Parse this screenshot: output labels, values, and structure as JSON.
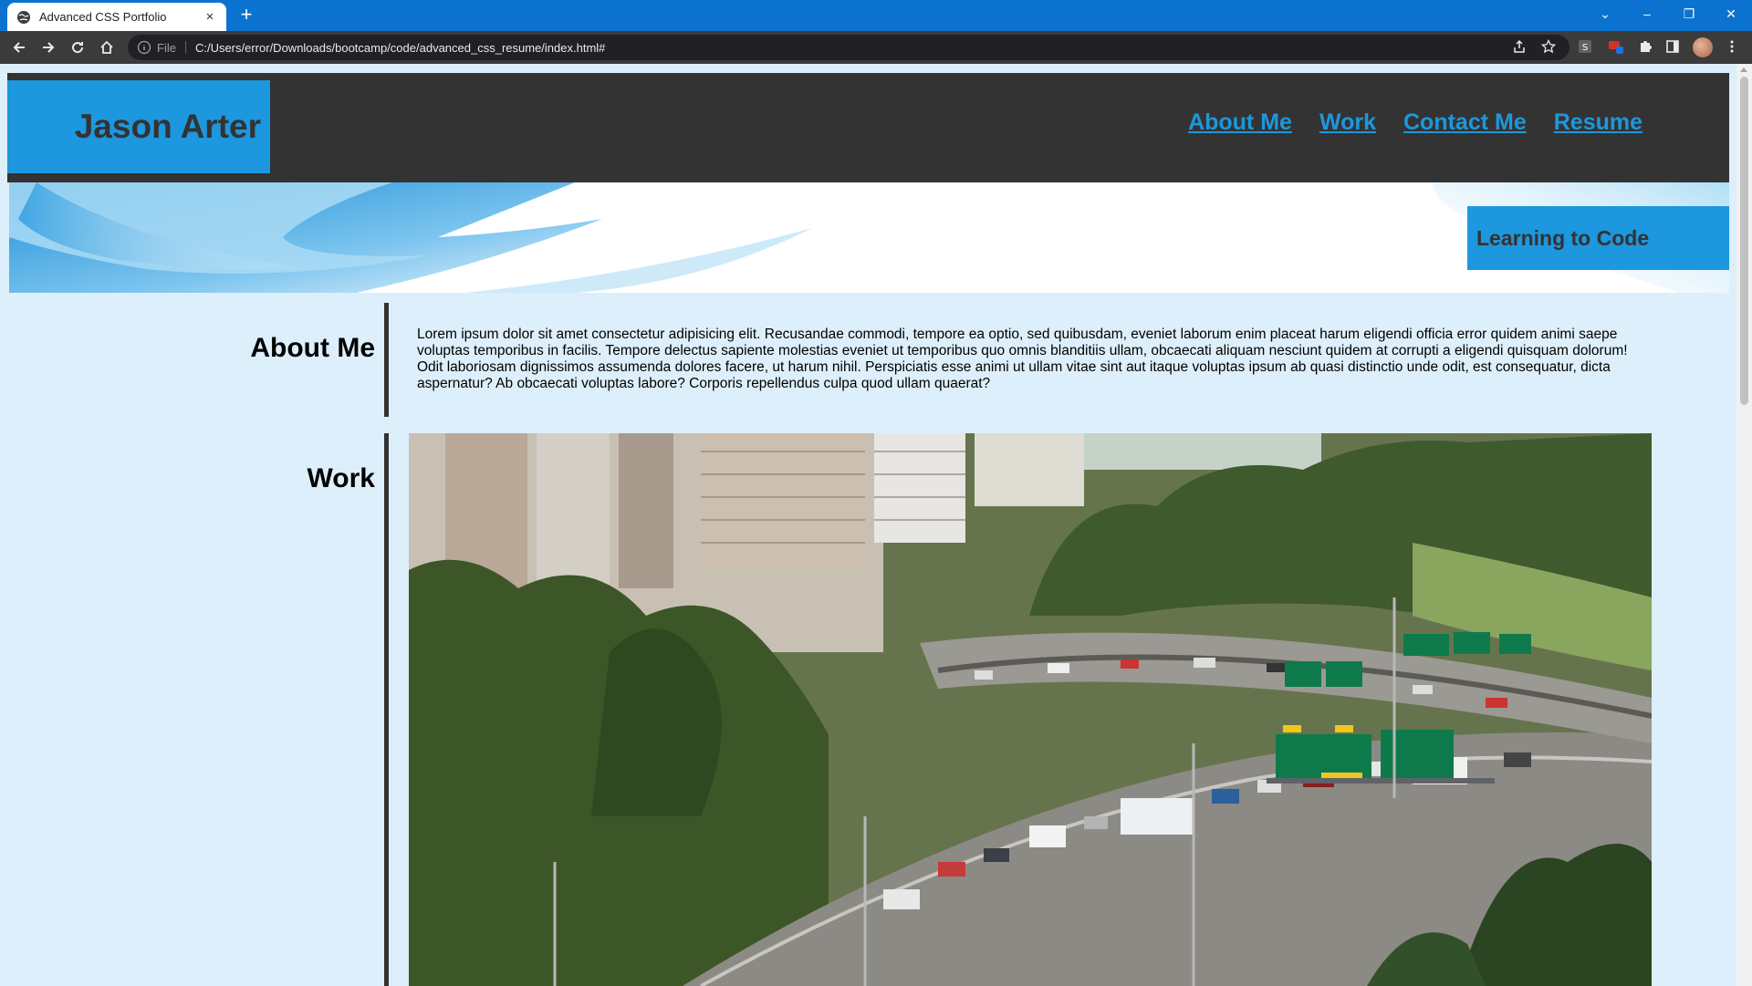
{
  "browser": {
    "tab_title": "Advanced CSS Portfolio",
    "tab_close": "×",
    "new_tab": "+",
    "file_label": "File",
    "url": "C:/Users/error/Downloads/bootcamp/code/advanced_css_resume/index.html#",
    "window_controls": [
      "⌄",
      "–",
      "❐",
      "✕"
    ]
  },
  "header": {
    "brand": "Jason Arter",
    "nav": [
      "About Me",
      "Work",
      "Contact Me",
      "Resume"
    ]
  },
  "hero": {
    "badge": "Learning to Code"
  },
  "about": {
    "title": "About Me",
    "body": "Lorem ipsum dolor sit amet consectetur adipisicing elit. Recusandae commodi, tempore ea optio, sed quibusdam, eveniet laborum enim placeat harum eligendi officia error quidem animi saepe voluptas temporibus in facilis. Tempore delectus sapiente molestias eveniet ut temporibus quo omnis blanditiis ullam, obcaecati aliquam nesciunt quidem at corrupti a eligendi quisquam dolorum! Odit laboriosam dignissimos assumenda dolores facere, ut harum nihil. Perspiciatis esse animi ut ullam vitae sint aut itaque voluptas ipsum ab quasi distinctio unde odit, est consequatur, dicta aspernatur? Ab obcaecati voluptas labore? Corporis repellendus culpa quod ullam quaerat?"
  },
  "work": {
    "title": "Work",
    "image_subject": "Seattle freeway traffic with highway signs and downtown buildings"
  },
  "icons": {
    "favicon": "globe-icon",
    "back": "back-arrow-icon",
    "forward": "forward-arrow-icon",
    "reload": "reload-icon",
    "home": "home-icon",
    "info": "info-icon",
    "share": "share-icon",
    "bookmark": "star-icon",
    "extensions": "puzzle-icon",
    "sidepanel": "side-panel-icon",
    "menu": "kebab-menu-icon"
  },
  "colors": {
    "accent": "#1d97dd",
    "header_bg": "#333333",
    "page_bg": "#ddeffa",
    "chrome_tabbar": "#0b73cf"
  }
}
